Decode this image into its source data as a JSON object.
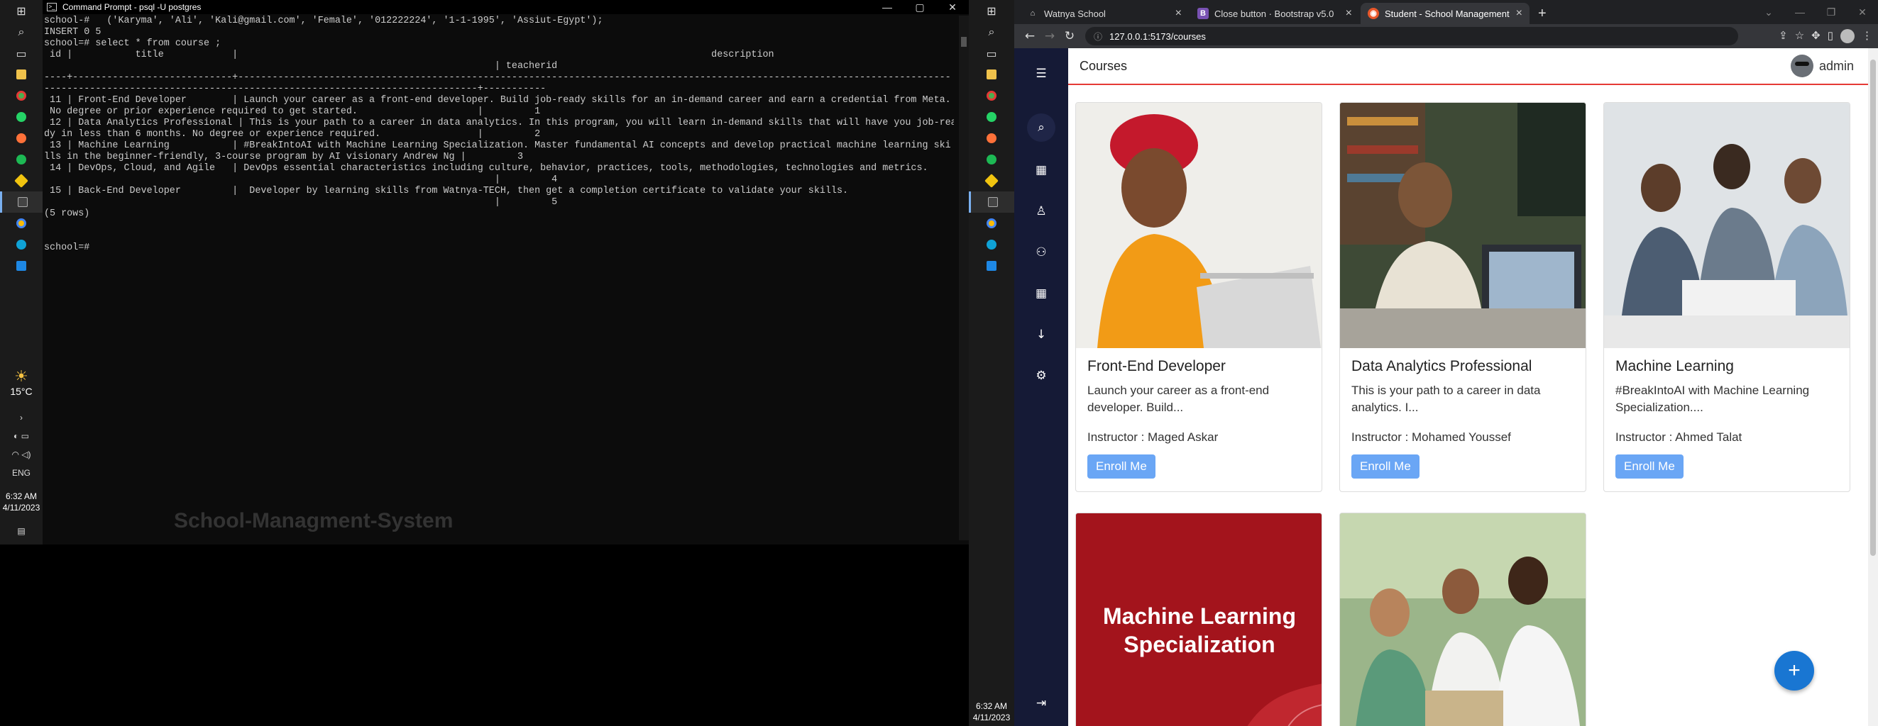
{
  "left": {
    "cmd_title": "Command Prompt - psql  -U postgres",
    "terminal_lines": [
      "school-#   ('Karyma', 'Ali', 'Kali@gmail.com', 'Female', '012222224', '1-1-1995', 'Assiut-Egypt');",
      "INSERT 0 5",
      "school=# select * from course ;",
      " id |           title            |                                                                                   description",
      "                                                                               | teacherid",
      "----+----------------------------+-----------------------------------------------------------------------------------------------------------------------------",
      "----------------------------------------------------------------------------+-----------",
      " 11 | Front-End Developer        | Launch your career as a front-end developer. Build job-ready skills for an in-demand career and earn a credential from Meta.",
      " No degree or prior experience required to get started.                     |         1",
      " 12 | Data Analytics Professional | This is your path to a career in data analytics. In this program, you will learn in-demand skills that will have you job-rea",
      "dy in less than 6 months. No degree or experience required.                 |         2",
      " 13 | Machine Learning           | #BreakIntoAI with Machine Learning Specialization. Master fundamental AI concepts and develop practical machine learning ski",
      "lls in the beginner-friendly, 3-course program by AI visionary Andrew Ng |         3",
      " 14 | DevOps, Cloud, and Agile   | DevOps essential characteristics including culture, behavior, practices, tools, methodologies, technologies and metrics.",
      "                                                                               |         4",
      " 15 | Back-End Developer         |  Developer by learning skills from Watnya-TECH, then get a completion certificate to validate your skills.",
      "                                                                               |         5",
      "(5 rows)",
      "",
      "",
      "school=#"
    ],
    "ghost_title": "School-Managment-System",
    "weather_temp": "15°C",
    "lang": "ENG",
    "clock_time": "6:32 AM",
    "clock_date": "4/11/2023"
  },
  "browser": {
    "tabs": [
      {
        "label": "Watnya School",
        "color": "#3c4043",
        "fav": "⌂"
      },
      {
        "label": "Close button · Bootstrap v5.0",
        "color": "#7952b3",
        "fav": "B"
      },
      {
        "label": "Student - School Management S",
        "color": "#e8572a",
        "fav": "◉"
      }
    ],
    "url": "127.0.0.1:5173/courses"
  },
  "app": {
    "page_title": "Courses",
    "username": "admin",
    "sidebar_icons": [
      "menu-icon",
      "search-icon",
      "dashboard-icon",
      "person-icon",
      "group-icon",
      "grid-icon",
      "download-icon",
      "settings-icon",
      "logout-icon"
    ],
    "enroll_label": "Enroll Me",
    "instructor_prefix": "Instructor : ",
    "courses": [
      {
        "title": "Front-End Developer",
        "desc": "Launch your career as a front-end developer. Build...",
        "instructor": "Instructor : Maged Askar"
      },
      {
        "title": "Data Analytics Professional",
        "desc": "This is your path to a career in data analytics. I...",
        "instructor": "Instructor : Mohamed Youssef"
      },
      {
        "title": "Machine Learning",
        "desc": "#BreakIntoAI with Machine Learning Specialization....",
        "instructor": "Instructor : Ahmed Talat"
      }
    ],
    "ml_banner": "Machine Learning Specialization",
    "fab_label": "+"
  },
  "right_clock": {
    "time": "6:32 AM",
    "date": "4/11/2023"
  },
  "colors": {
    "accent_red": "#e53935",
    "sidebar": "#151a36",
    "enroll": "#6aa6f5",
    "fab": "#1976d2"
  }
}
